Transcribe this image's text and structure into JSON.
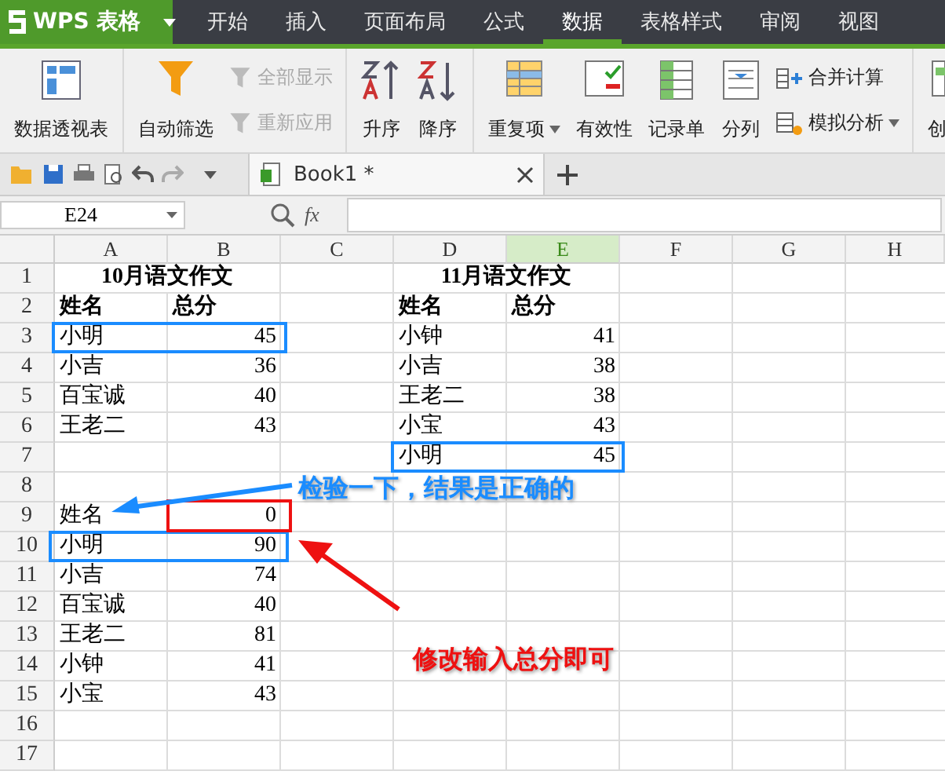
{
  "app": {
    "name": "WPS 表格"
  },
  "menu_tabs": [
    {
      "label": "开始",
      "selected": false
    },
    {
      "label": "插入",
      "selected": false
    },
    {
      "label": "页面布局",
      "selected": false
    },
    {
      "label": "公式",
      "selected": false
    },
    {
      "label": "数据",
      "selected": true
    },
    {
      "label": "表格样式",
      "selected": false
    },
    {
      "label": "审阅",
      "selected": false
    },
    {
      "label": "视图",
      "selected": false
    }
  ],
  "ribbon_groups": [
    {
      "items": [
        {
          "kind": "large",
          "label": "数据透视表",
          "disabled": false,
          "dropdown": false
        }
      ]
    },
    {
      "items": [
        {
          "kind": "large",
          "label": "自动筛选",
          "disabled": false,
          "dropdown": false
        },
        {
          "kind": "stack",
          "items": [
            {
              "label": "全部显示",
              "disabled": true,
              "dropdown": false
            },
            {
              "label": "重新应用",
              "disabled": true,
              "dropdown": false
            }
          ]
        }
      ]
    },
    {
      "items": [
        {
          "kind": "large",
          "label": "升序",
          "disabled": false,
          "dropdown": false
        },
        {
          "kind": "large",
          "label": "降序",
          "disabled": false,
          "dropdown": false
        }
      ]
    },
    {
      "items": [
        {
          "kind": "large",
          "label": "重复项",
          "disabled": false,
          "dropdown": true
        },
        {
          "kind": "large",
          "label": "有效性",
          "disabled": false,
          "dropdown": false
        },
        {
          "kind": "large",
          "label": "记录单",
          "disabled": false,
          "dropdown": false
        },
        {
          "kind": "large",
          "label": "分列",
          "disabled": false,
          "dropdown": false
        },
        {
          "kind": "stack",
          "items": [
            {
              "label": "合并计算",
              "disabled": false,
              "dropdown": false
            },
            {
              "label": "模拟分析",
              "disabled": false,
              "dropdown": true
            }
          ]
        }
      ]
    },
    {
      "items": [
        {
          "kind": "large",
          "label": "创",
          "disabled": false,
          "dropdown": false
        }
      ]
    }
  ],
  "document_tab": {
    "title": "Book1 *"
  },
  "name_box": {
    "value": "E24"
  },
  "formula": {
    "label": "fx"
  },
  "columns": [
    {
      "label": "A",
      "selected": false
    },
    {
      "label": "B",
      "selected": false
    },
    {
      "label": "C",
      "selected": false
    },
    {
      "label": "D",
      "selected": false
    },
    {
      "label": "E",
      "selected": true
    },
    {
      "label": "F",
      "selected": false
    },
    {
      "label": "G",
      "selected": false
    },
    {
      "label": "H",
      "selected": false
    }
  ],
  "rows": [
    {
      "number": "1",
      "cells": [
        {
          "kind": "title",
          "text": "10月语文作文"
        },
        {
          "kind": "blank"
        },
        {
          "kind": "title",
          "text": "11月语文作文"
        },
        {
          "kind": "blank"
        },
        {
          "kind": "blank"
        },
        {
          "kind": "blank"
        }
      ]
    },
    {
      "number": "2",
      "cells": [
        {
          "kind": "header",
          "text": "姓名"
        },
        {
          "kind": "header",
          "text": "总分"
        },
        {
          "kind": "blank"
        },
        {
          "kind": "header",
          "text": "姓名"
        },
        {
          "kind": "header",
          "text": "总分"
        },
        {
          "kind": "blank"
        },
        {
          "kind": "blank"
        },
        {
          "kind": "blank"
        }
      ]
    },
    {
      "number": "3",
      "cells": [
        {
          "kind": "text",
          "text": "小明"
        },
        {
          "kind": "number",
          "text": "45"
        },
        {
          "kind": "blank"
        },
        {
          "kind": "text",
          "text": "小钟"
        },
        {
          "kind": "number",
          "text": "41"
        },
        {
          "kind": "blank"
        },
        {
          "kind": "blank"
        },
        {
          "kind": "blank"
        }
      ]
    },
    {
      "number": "4",
      "cells": [
        {
          "kind": "text",
          "text": "小吉"
        },
        {
          "kind": "number",
          "text": "36"
        },
        {
          "kind": "blank"
        },
        {
          "kind": "text",
          "text": "小吉"
        },
        {
          "kind": "number",
          "text": "38"
        },
        {
          "kind": "blank"
        },
        {
          "kind": "blank"
        },
        {
          "kind": "blank"
        }
      ]
    },
    {
      "number": "5",
      "cells": [
        {
          "kind": "text",
          "text": "百宝诚"
        },
        {
          "kind": "number",
          "text": "40"
        },
        {
          "kind": "blank"
        },
        {
          "kind": "text",
          "text": "王老二"
        },
        {
          "kind": "number",
          "text": "38"
        },
        {
          "kind": "blank"
        },
        {
          "kind": "blank"
        },
        {
          "kind": "blank"
        }
      ]
    },
    {
      "number": "6",
      "cells": [
        {
          "kind": "text",
          "text": "王老二"
        },
        {
          "kind": "number",
          "text": "43"
        },
        {
          "kind": "blank"
        },
        {
          "kind": "text",
          "text": "小宝"
        },
        {
          "kind": "number",
          "text": "43"
        },
        {
          "kind": "blank"
        },
        {
          "kind": "blank"
        },
        {
          "kind": "blank"
        }
      ]
    },
    {
      "number": "7",
      "cells": [
        {
          "kind": "blank"
        },
        {
          "kind": "blank"
        },
        {
          "kind": "blank"
        },
        {
          "kind": "text",
          "text": "小明"
        },
        {
          "kind": "number",
          "text": "45"
        },
        {
          "kind": "blank"
        },
        {
          "kind": "blank"
        },
        {
          "kind": "blank"
        }
      ]
    },
    {
      "number": "8",
      "cells": [
        {
          "kind": "blank"
        },
        {
          "kind": "blank"
        },
        {
          "kind": "blank"
        },
        {
          "kind": "blank"
        },
        {
          "kind": "blank"
        },
        {
          "kind": "blank"
        },
        {
          "kind": "blank"
        },
        {
          "kind": "blank"
        }
      ]
    },
    {
      "number": "9",
      "cells": [
        {
          "kind": "text",
          "text": "姓名"
        },
        {
          "kind": "number",
          "text": "0"
        },
        {
          "kind": "blank"
        },
        {
          "kind": "blank"
        },
        {
          "kind": "blank"
        },
        {
          "kind": "blank"
        },
        {
          "kind": "blank"
        },
        {
          "kind": "blank"
        }
      ]
    },
    {
      "number": "10",
      "cells": [
        {
          "kind": "text",
          "text": "小明"
        },
        {
          "kind": "number",
          "text": "90"
        },
        {
          "kind": "blank"
        },
        {
          "kind": "blank"
        },
        {
          "kind": "blank"
        },
        {
          "kind": "blank"
        },
        {
          "kind": "blank"
        },
        {
          "kind": "blank"
        }
      ]
    },
    {
      "number": "11",
      "cells": [
        {
          "kind": "text",
          "text": "小吉"
        },
        {
          "kind": "number",
          "text": "74"
        },
        {
          "kind": "blank"
        },
        {
          "kind": "blank"
        },
        {
          "kind": "blank"
        },
        {
          "kind": "blank"
        },
        {
          "kind": "blank"
        },
        {
          "kind": "blank"
        }
      ]
    },
    {
      "number": "12",
      "cells": [
        {
          "kind": "text",
          "text": "百宝诚"
        },
        {
          "kind": "number",
          "text": "40"
        },
        {
          "kind": "blank"
        },
        {
          "kind": "blank"
        },
        {
          "kind": "blank"
        },
        {
          "kind": "blank"
        },
        {
          "kind": "blank"
        },
        {
          "kind": "blank"
        }
      ]
    },
    {
      "number": "13",
      "cells": [
        {
          "kind": "text",
          "text": "王老二"
        },
        {
          "kind": "number",
          "text": "81"
        },
        {
          "kind": "blank"
        },
        {
          "kind": "blank"
        },
        {
          "kind": "blank"
        },
        {
          "kind": "blank"
        },
        {
          "kind": "blank"
        },
        {
          "kind": "blank"
        }
      ]
    },
    {
      "number": "14",
      "cells": [
        {
          "kind": "text",
          "text": "小钟"
        },
        {
          "kind": "number",
          "text": "41"
        },
        {
          "kind": "blank"
        },
        {
          "kind": "blank"
        },
        {
          "kind": "blank"
        },
        {
          "kind": "blank"
        },
        {
          "kind": "blank"
        },
        {
          "kind": "blank"
        }
      ]
    },
    {
      "number": "15",
      "cells": [
        {
          "kind": "text",
          "text": "小宝"
        },
        {
          "kind": "number",
          "text": "43"
        },
        {
          "kind": "blank"
        },
        {
          "kind": "blank"
        },
        {
          "kind": "blank"
        },
        {
          "kind": "blank"
        },
        {
          "kind": "blank"
        },
        {
          "kind": "blank"
        }
      ]
    },
    {
      "number": "16",
      "cells": [
        {
          "kind": "blank"
        },
        {
          "kind": "blank"
        },
        {
          "kind": "blank"
        },
        {
          "kind": "blank"
        },
        {
          "kind": "blank"
        },
        {
          "kind": "blank"
        },
        {
          "kind": "blank"
        },
        {
          "kind": "blank"
        }
      ]
    },
    {
      "number": "17",
      "cells": [
        {
          "kind": "blank"
        },
        {
          "kind": "blank"
        },
        {
          "kind": "blank"
        },
        {
          "kind": "blank"
        },
        {
          "kind": "blank"
        },
        {
          "kind": "blank"
        },
        {
          "kind": "blank"
        },
        {
          "kind": "blank"
        }
      ]
    }
  ],
  "annotations": [
    {
      "kind": "note",
      "text": "检验一下，结果是正确的",
      "color": "#1a8cff"
    },
    {
      "kind": "note",
      "text": "修改输入总分即可",
      "color": "#ee1111"
    }
  ]
}
